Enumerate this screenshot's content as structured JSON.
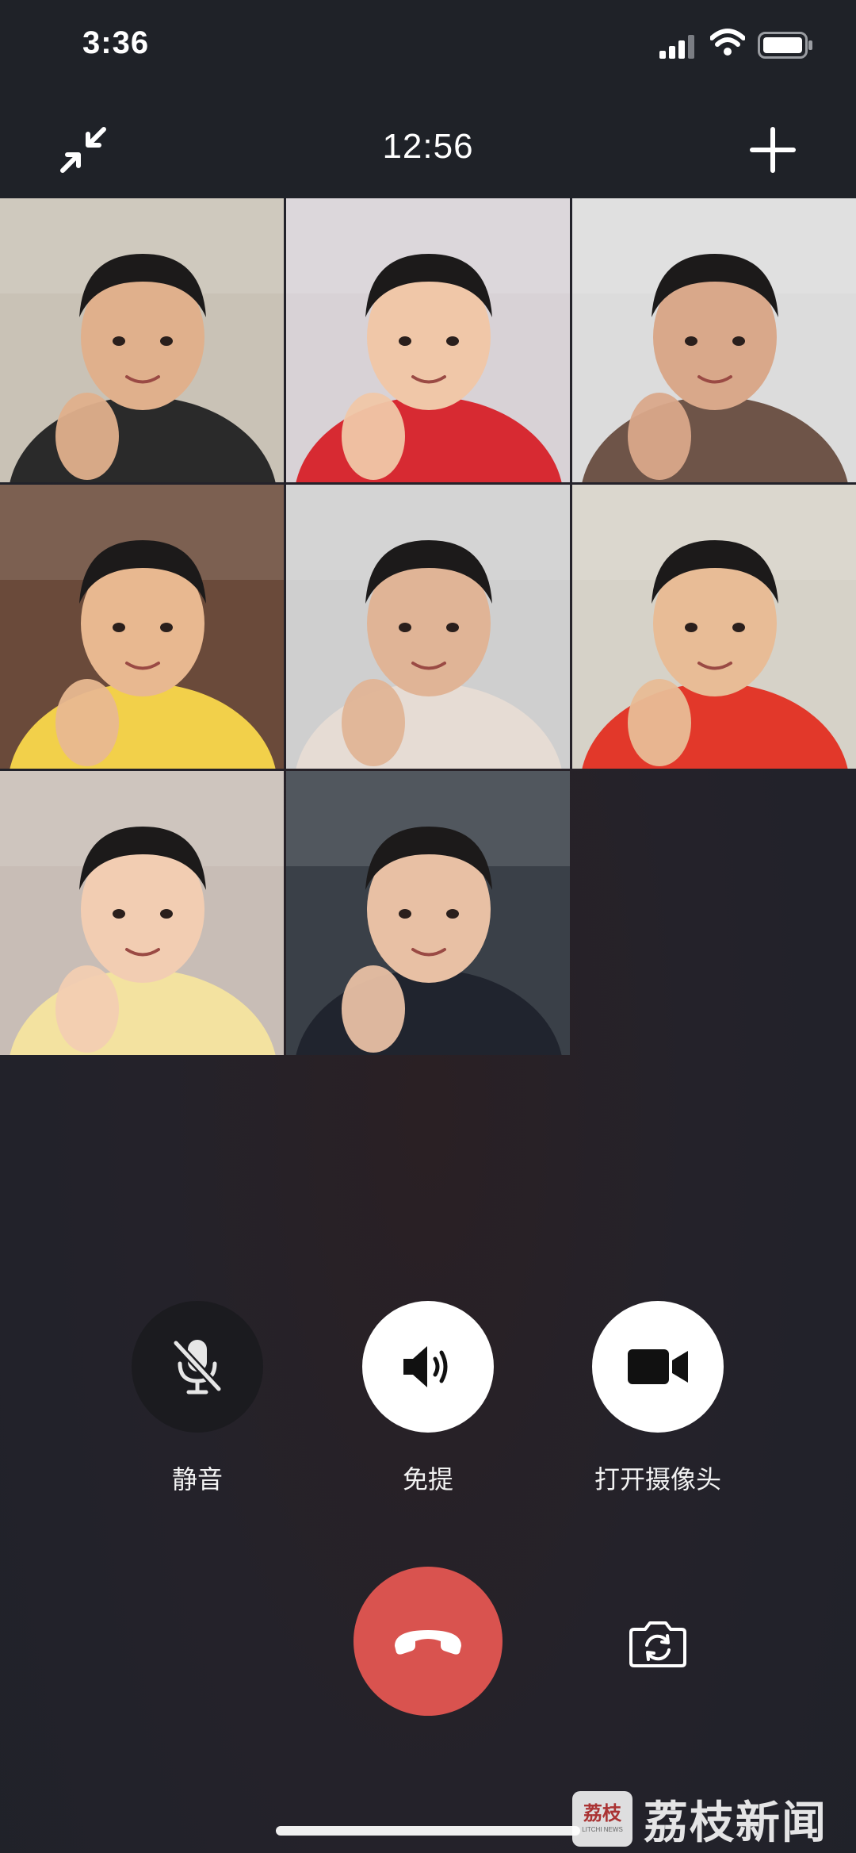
{
  "status_bar": {
    "time": "3:36"
  },
  "header": {
    "call_duration": "12:56"
  },
  "participants": [
    {
      "name": "participant-1",
      "bg": "#c9c2b6",
      "shirt": "#2a2a2a",
      "skin": "#e0b08c"
    },
    {
      "name": "participant-2",
      "bg": "#d8d2d6",
      "shirt": "#d72a32",
      "skin": "#f0c7a8"
    },
    {
      "name": "participant-3",
      "bg": "#dcdcdc",
      "shirt": "#6e5448",
      "skin": "#d9a88a"
    },
    {
      "name": "participant-4",
      "bg": "#6a4a3a",
      "shirt": "#f2d04a",
      "skin": "#e8b890"
    },
    {
      "name": "participant-5",
      "bg": "#cfcfcf",
      "shirt": "#e6dcd4",
      "skin": "#e0b496"
    },
    {
      "name": "participant-6",
      "bg": "#d6d2c8",
      "shirt": "#e2382a",
      "skin": "#e8bc96"
    },
    {
      "name": "participant-7",
      "bg": "#c8bdb6",
      "shirt": "#f3e2a0",
      "skin": "#f2cdb2"
    },
    {
      "name": "participant-8",
      "bg": "#3a4048",
      "shirt": "#20242e",
      "skin": "#e8c0a4"
    }
  ],
  "controls": {
    "mute_label": "静音",
    "speaker_label": "免提",
    "camera_label": "打开摄像头"
  },
  "watermark": {
    "badge": "荔枝",
    "badge_sub": "LITCHI NEWS",
    "text": "荔枝新闻"
  },
  "colors": {
    "hangup": "#d9534f",
    "background": "#24222a"
  }
}
